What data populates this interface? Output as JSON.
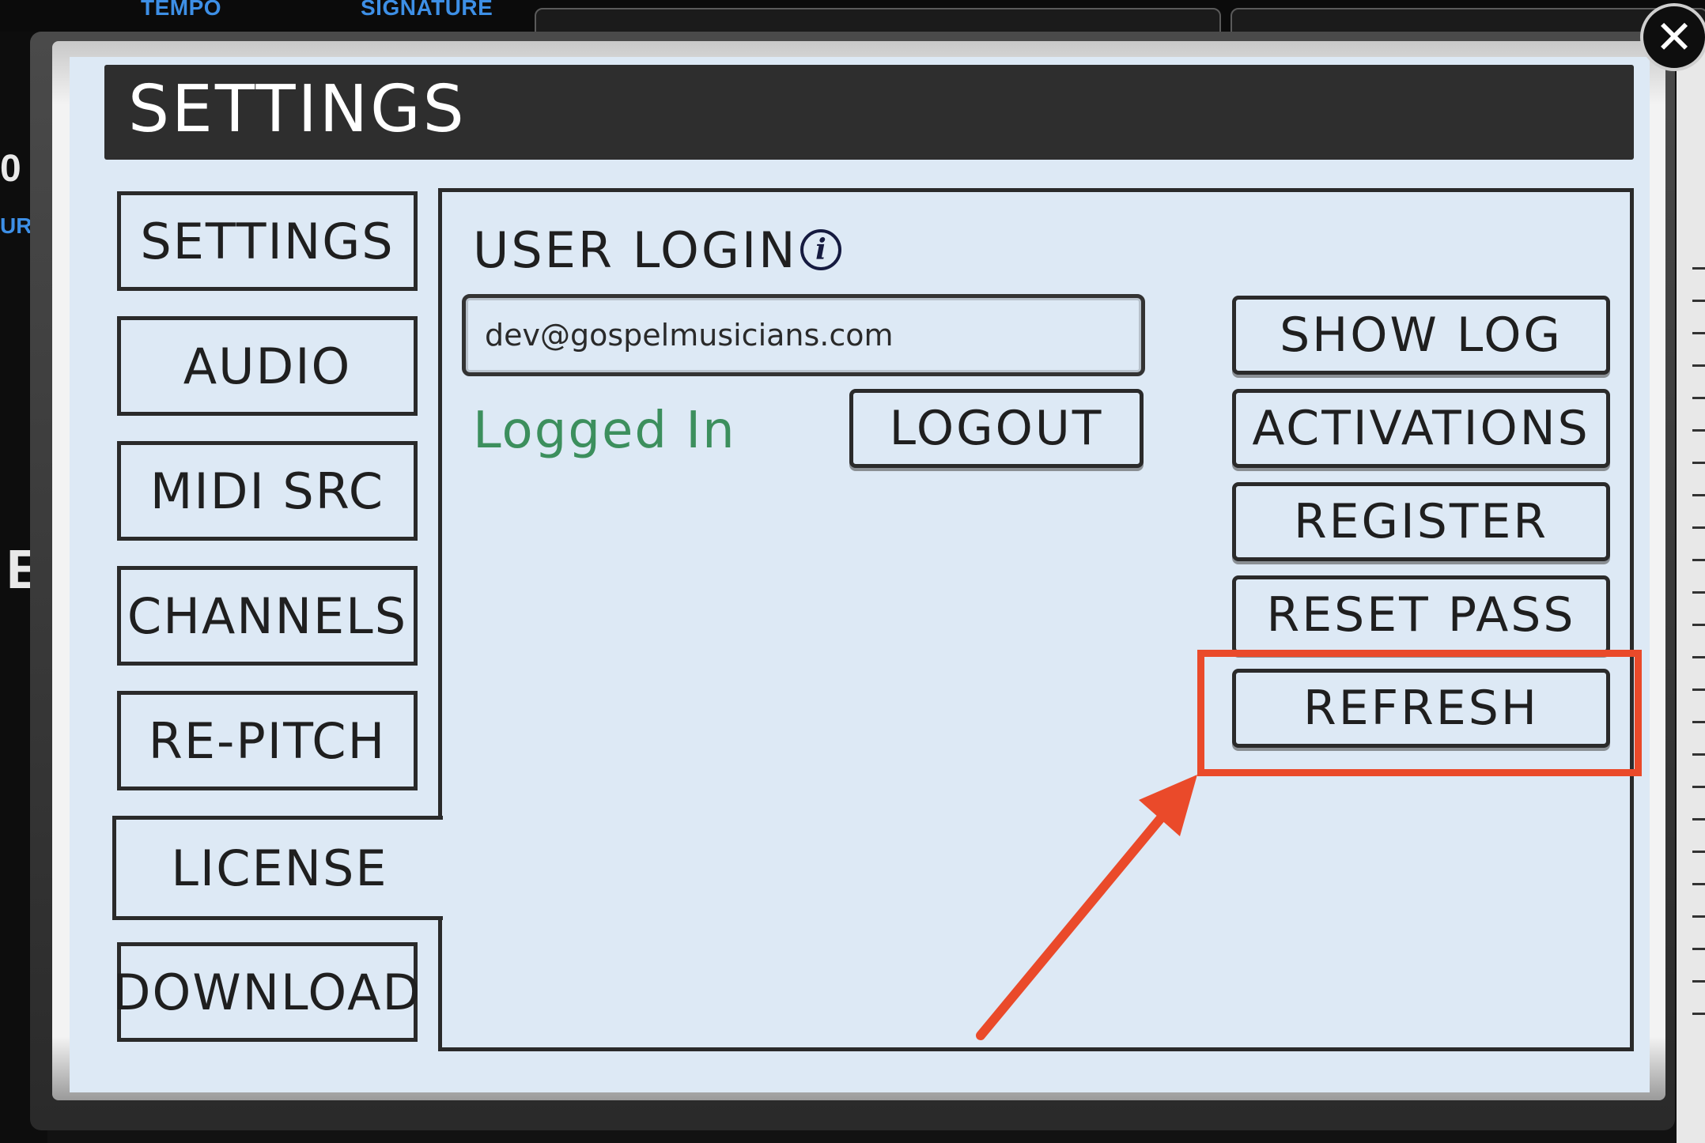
{
  "background": {
    "tempo_label": "TEMPO",
    "signature_label": "SIGNATURE",
    "left_fragments": [
      "0 :",
      "UR",
      "E"
    ]
  },
  "dialog": {
    "title": "SETTINGS",
    "close_glyph": "✕"
  },
  "sidebar": {
    "items": [
      {
        "label": "SETTINGS"
      },
      {
        "label": "AUDIO"
      },
      {
        "label": "MIDI SRC"
      },
      {
        "label": "CHANNELS"
      },
      {
        "label": "RE-PITCH"
      },
      {
        "label": "LICENSE",
        "active": true
      },
      {
        "label": "DOWNLOAD"
      }
    ]
  },
  "license": {
    "heading": "USER LOGIN",
    "info_glyph": "i",
    "email_value": "dev@gospelmusicians.com",
    "status": "Logged In",
    "logout_label": "LOGOUT",
    "actions": [
      {
        "label": "SHOW LOG"
      },
      {
        "label": "ACTIVATIONS"
      },
      {
        "label": "REGISTER"
      },
      {
        "label": "RESET PASS"
      },
      {
        "label": "REFRESH",
        "highlighted": true
      }
    ]
  },
  "colors": {
    "panel_bg": "#dde9f5",
    "title_bar": "#2e2e2e",
    "status_green": "#3c8f5d",
    "highlight_red": "#ea4a2a",
    "background_blue_text": "#3d8fe6"
  }
}
